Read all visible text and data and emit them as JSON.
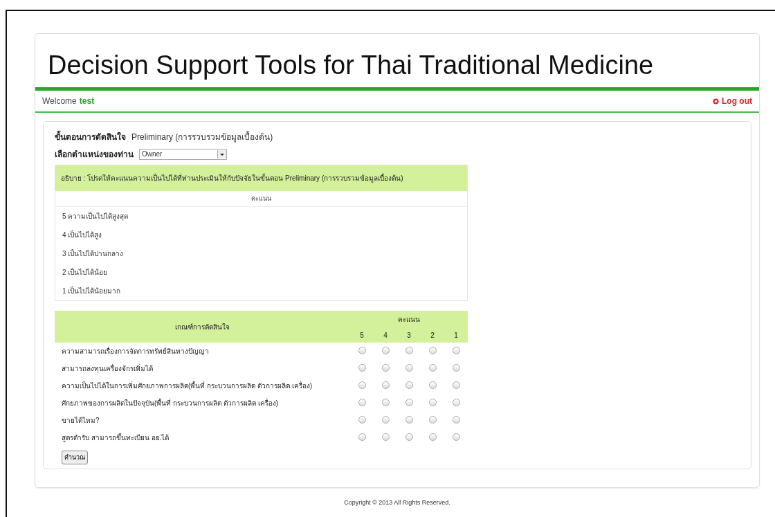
{
  "header": {
    "title": "Decision Support Tools for Thai Traditional Medicine"
  },
  "user_bar": {
    "welcome": "Welcome",
    "username": "test",
    "logout": "Log out"
  },
  "form": {
    "step_label": "ขั้นตอนการตัดสินใจ",
    "step_value": "Preliminary (การรวบรวมข้อมูลเบื้องต้น)",
    "position_label": "เลือกตำแหน่งของท่าน",
    "position_select": {
      "value": "Owner"
    }
  },
  "legend": {
    "description": "อธิบาย : โปรดให้คะแนนความเป็นไปได้ที่ท่านประเมินให้กับปัจจัยในขั้นตอน Preliminary (การรวบรวมข้อมูลเบื้องต้น)",
    "heading": "คะแนน",
    "items": [
      "5 ความเป็นไปได้สูงสุด",
      "4 เป็นไปได้สูง",
      "3 เป็นไปได้ปานกลาง",
      "2 เป็นไปได้น้อย",
      "1 เป็นไปได้น้อยมาก"
    ]
  },
  "criteria": {
    "criteria_heading": "เกณฑ์การตัดสินใจ",
    "score_heading": "คะแนน",
    "score_columns": [
      "5",
      "4",
      "3",
      "2",
      "1"
    ],
    "rows": [
      {
        "label": "ความสามารถเรื่องการจัดการทรัพย์สินทางปัญญา",
        "options": [
          {
            "selected": false
          },
          {
            "selected": false
          },
          {
            "selected": false
          },
          {
            "selected": false
          },
          {
            "selected": false
          }
        ]
      },
      {
        "label": "สามารถลงทุนเครื่องจักรเพิ่มได้",
        "options": [
          {
            "selected": false
          },
          {
            "selected": false
          },
          {
            "selected": false
          },
          {
            "selected": false
          },
          {
            "selected": false
          }
        ]
      },
      {
        "label": "ความเป็นไปได้ในการเพิ่มศักยภาพการผลิต(พื้นที่ กระบวนการผลิต ตัวการผลิต เครื่อง)",
        "options": [
          {
            "selected": false
          },
          {
            "selected": false
          },
          {
            "selected": false
          },
          {
            "selected": false
          },
          {
            "selected": false
          }
        ]
      },
      {
        "label": "ศักยภาพของการผลิตในปัจจุบัน(พื้นที่ กระบวนการผลิต ตัวการผลิต เครื่อง)",
        "options": [
          {
            "selected": false
          },
          {
            "selected": false
          },
          {
            "selected": false
          },
          {
            "selected": false
          },
          {
            "selected": false
          }
        ]
      },
      {
        "label": "ขายได้ไหม?",
        "options": [
          {
            "selected": false
          },
          {
            "selected": false
          },
          {
            "selected": false
          },
          {
            "selected": false
          },
          {
            "selected": false
          }
        ]
      },
      {
        "label": "สูตรตำรับ สามารถขึ้นทะเบียน อย.ได้",
        "options": [
          {
            "selected": false
          },
          {
            "selected": false
          },
          {
            "selected": false
          },
          {
            "selected": false
          },
          {
            "selected": false
          }
        ]
      }
    ],
    "calculate_button": "คำนวณ"
  },
  "footer": {
    "copyright": "Copyright © 2013 All Rights Reserved."
  }
}
